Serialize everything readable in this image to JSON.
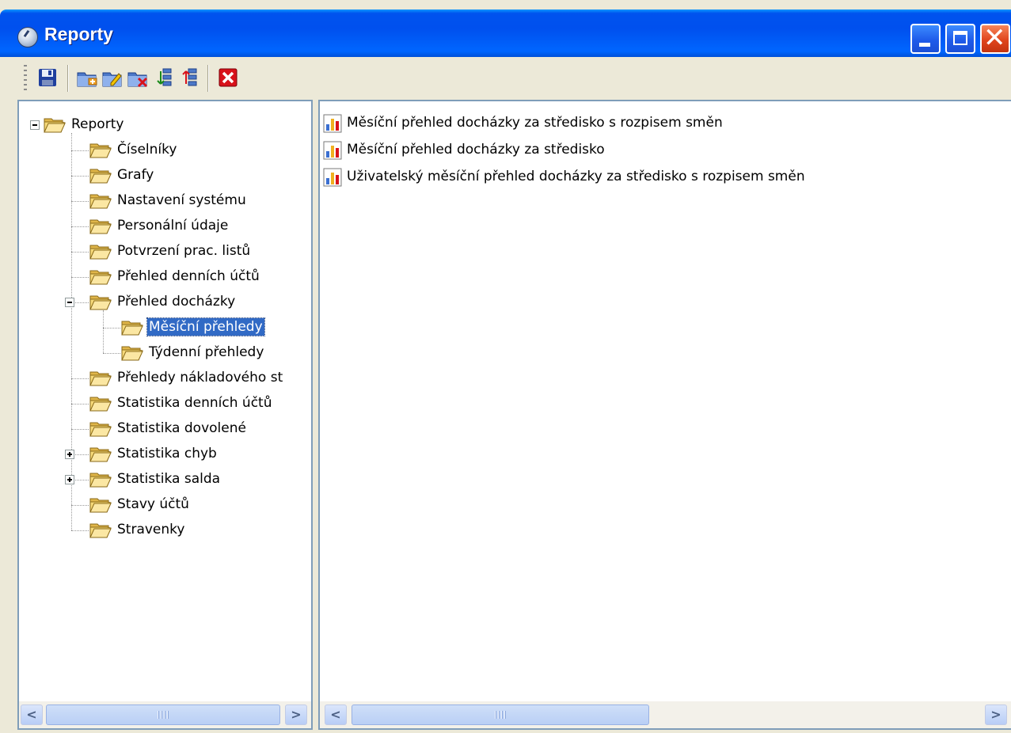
{
  "window": {
    "title": "Reporty"
  },
  "toolbar": {
    "buttons": [
      {
        "icon": "save-icon"
      },
      {
        "icon": "new-folder-icon"
      },
      {
        "icon": "edit-folder-icon"
      },
      {
        "icon": "delete-folder-icon"
      },
      {
        "icon": "move-down-icon"
      },
      {
        "icon": "move-up-icon"
      },
      {
        "icon": "close-icon"
      }
    ]
  },
  "tree": {
    "root": "Reporty",
    "items": [
      "Číselníky",
      "Grafy",
      "Nastavení systému",
      "Personální údaje",
      "Potvrzení prac. listů",
      "Přehled denních účtů",
      "Přehled docházky",
      "Měsíční přehledy",
      "Týdenní přehledy",
      "Přehledy nákladového st",
      "Statistika denních účtů",
      "Statistika dovolené",
      "Statistika chyb",
      "Statistika salda",
      "Stavy účtů",
      "Stravenky"
    ],
    "selected": "Měsíční přehledy"
  },
  "reports": [
    "Měsíční přehled docházky za středisko s rozpisem směn",
    "Měsíční přehled docházky za středisko",
    "Uživatelský měsíční přehled docházky za středisko s rozpisem směn"
  ],
  "colors": {
    "title_bar": "#0050ee",
    "selection": "#316ac5",
    "pane_border": "#7f9db9"
  }
}
